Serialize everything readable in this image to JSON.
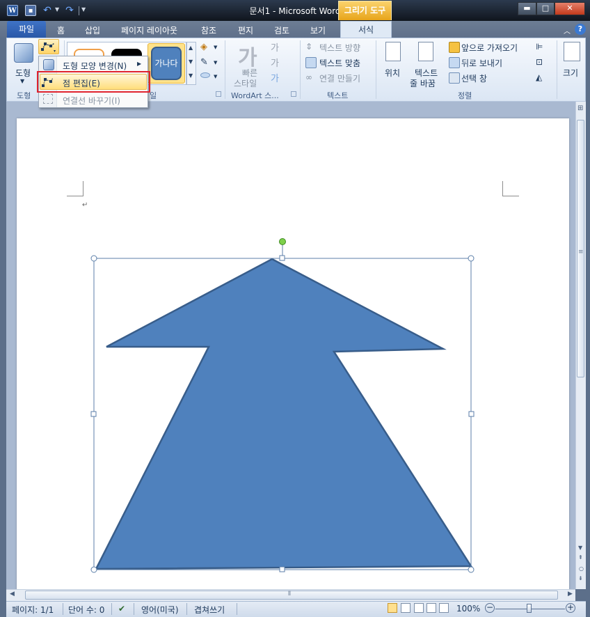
{
  "window": {
    "title": "문서1 - Microsoft Word",
    "context_tab_title": "그리기 도구"
  },
  "quick_access": {
    "word_icon": "W"
  },
  "tabs": [
    {
      "label": "파일"
    },
    {
      "label": "홈"
    },
    {
      "label": "삽입"
    },
    {
      "label": "페이지 레이아웃"
    },
    {
      "label": "참조"
    },
    {
      "label": "편지"
    },
    {
      "label": "검토"
    },
    {
      "label": "보기"
    },
    {
      "label": "서식"
    }
  ],
  "ribbon": {
    "shapes_group": {
      "big_button": "도형",
      "group_label": "도형"
    },
    "styles_group": {
      "sample_text": "가나다",
      "group_label_tail": "일"
    },
    "wordart_group": {
      "glyph": "가",
      "quick_style_line1": "빠른",
      "quick_style_line2": "스타일",
      "group_label": "WordArt 스..."
    },
    "text_group": {
      "direction": "텍스트 방향",
      "align": "텍스트 맞춤",
      "link": "연결 만들기",
      "group_label": "텍스트"
    },
    "arrange_group": {
      "position": "위치",
      "wrap_line1": "텍스트",
      "wrap_line2": "줄 바꿈",
      "bring_forward": "앞으로 가져오기",
      "send_backward": "뒤로 보내기",
      "selection_pane": "선택 창",
      "group_label": "정렬"
    },
    "size_group": {
      "label": "크기"
    }
  },
  "dropdown_menu": {
    "items": [
      {
        "label": "도형 모양 변경(N)",
        "enabled": true,
        "has_submenu": true
      },
      {
        "label": "점 편집(E)",
        "enabled": true,
        "highlighted": true
      },
      {
        "label": "연결선 바꾸기(I)",
        "enabled": false
      }
    ]
  },
  "document": {
    "paragraph_mark": "↵",
    "shape": "freeform-arrow",
    "shape_fill": "#4f81bd",
    "shape_outline": "#385d8a"
  },
  "status_bar": {
    "page": "페이지: 1/1",
    "words": "단어 수: 0",
    "language": "영어(미국)",
    "mode": "겹쳐쓰기",
    "zoom": "100%"
  },
  "colors": {
    "accent": "#2b579a",
    "context_tab": "#f0b53c",
    "highlight_border": "#e0232e"
  }
}
